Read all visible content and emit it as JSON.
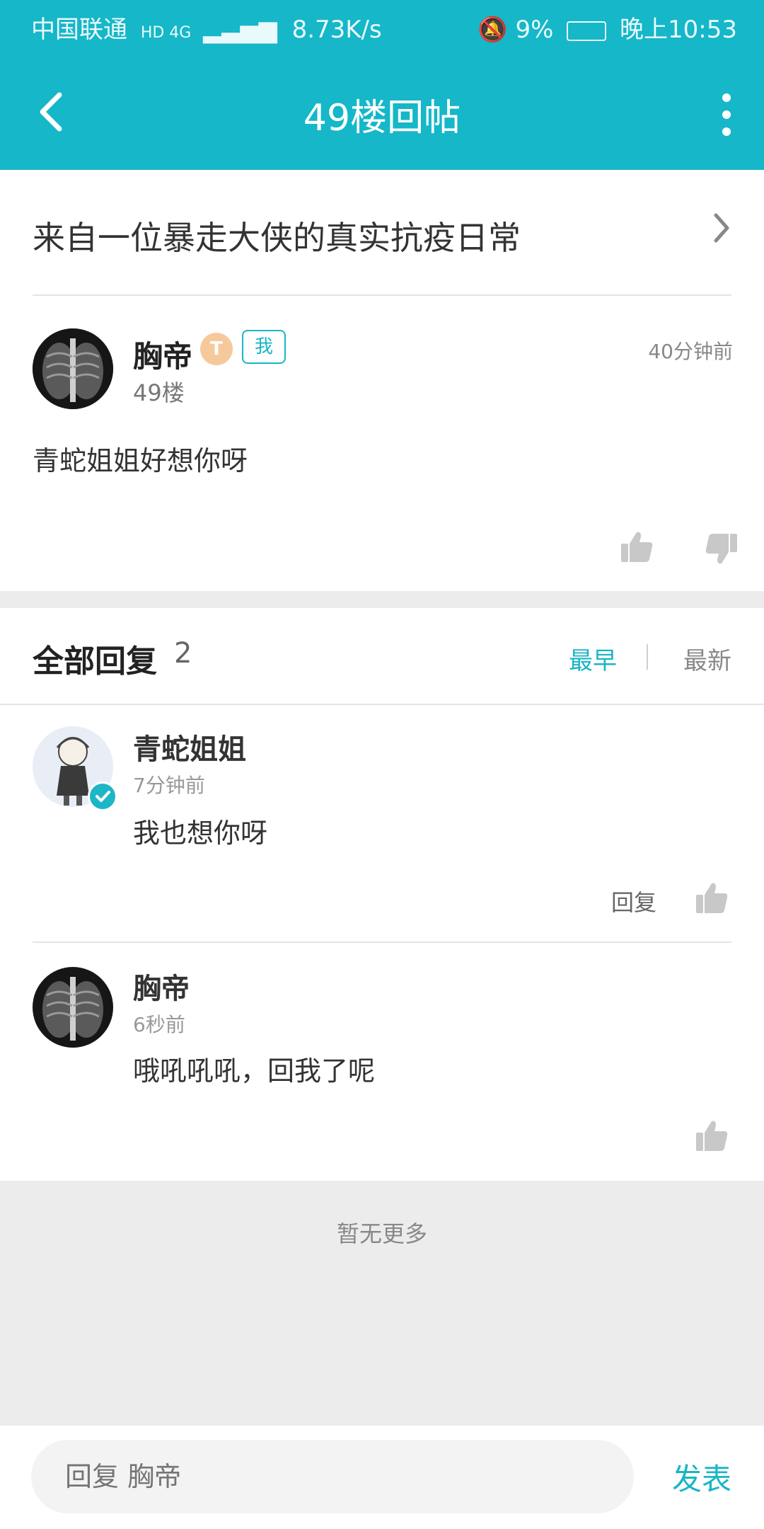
{
  "status_bar": {
    "carrier": "中国联通",
    "network": "HD 4G",
    "speed": "8.73K/s",
    "battery": "9%",
    "time": "晚上10:53"
  },
  "header": {
    "title": "49楼回帖"
  },
  "thread": {
    "title": "来自一位暴走大侠的真实抗疫日常"
  },
  "post": {
    "author": "胸帝",
    "level_badge": "T",
    "me_badge": "我",
    "floor": "49楼",
    "time": "40分钟前",
    "content": "青蛇姐姐好想你呀"
  },
  "replies": {
    "title": "全部回复",
    "count": "2",
    "sort_earliest": "最早",
    "sort_latest": "最新",
    "items": [
      {
        "author": "青蛇姐姐",
        "time": "7分钟前",
        "content": "我也想你呀",
        "reply_label": "回复"
      },
      {
        "author": "胸帝",
        "time": "6秒前",
        "content": "哦吼吼吼，回我了呢"
      }
    ]
  },
  "no_more": "暂无更多",
  "bottom_bar": {
    "placeholder": "回复 胸帝",
    "send_label": "发表"
  },
  "colors": {
    "accent": "#15b7c8",
    "background_gray": "#ececec"
  }
}
